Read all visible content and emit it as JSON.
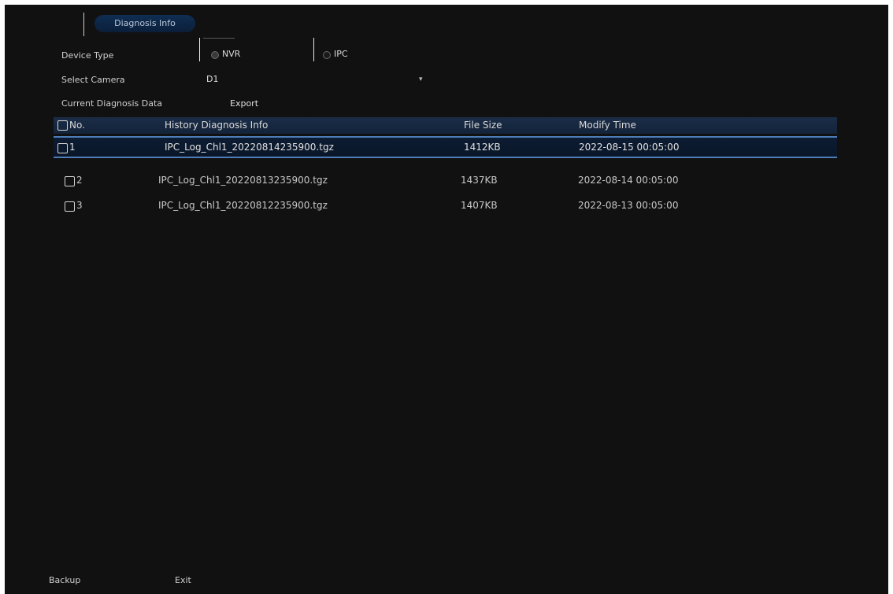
{
  "tab": {
    "label": "Diagnosis Info"
  },
  "device_type": {
    "label": "Device Type",
    "options": [
      "NVR",
      "IPC"
    ],
    "selected": "NVR"
  },
  "select_camera": {
    "label": "Select Camera",
    "value": "D1"
  },
  "current_diagnosis": {
    "label": "Current Diagnosis Data",
    "action": "Export"
  },
  "table": {
    "columns": [
      "No.",
      "History Diagnosis Info",
      "File Size",
      "Modify Time"
    ],
    "rows": [
      {
        "no": "1",
        "name": "IPC_Log_Chl1_20220814235900.tgz",
        "size": "1412KB",
        "time": "2022-08-15 00:05:00"
      },
      {
        "no": "2",
        "name": "IPC_Log_Chl1_20220813235900.tgz",
        "size": "1437KB",
        "time": "2022-08-14 00:05:00"
      },
      {
        "no": "3",
        "name": "IPC_Log_Chl1_20220812235900.tgz",
        "size": "1407KB",
        "time": "2022-08-13 00:05:00"
      }
    ]
  },
  "footer": {
    "backup_label": "Backup",
    "backup_action": "Exit"
  }
}
